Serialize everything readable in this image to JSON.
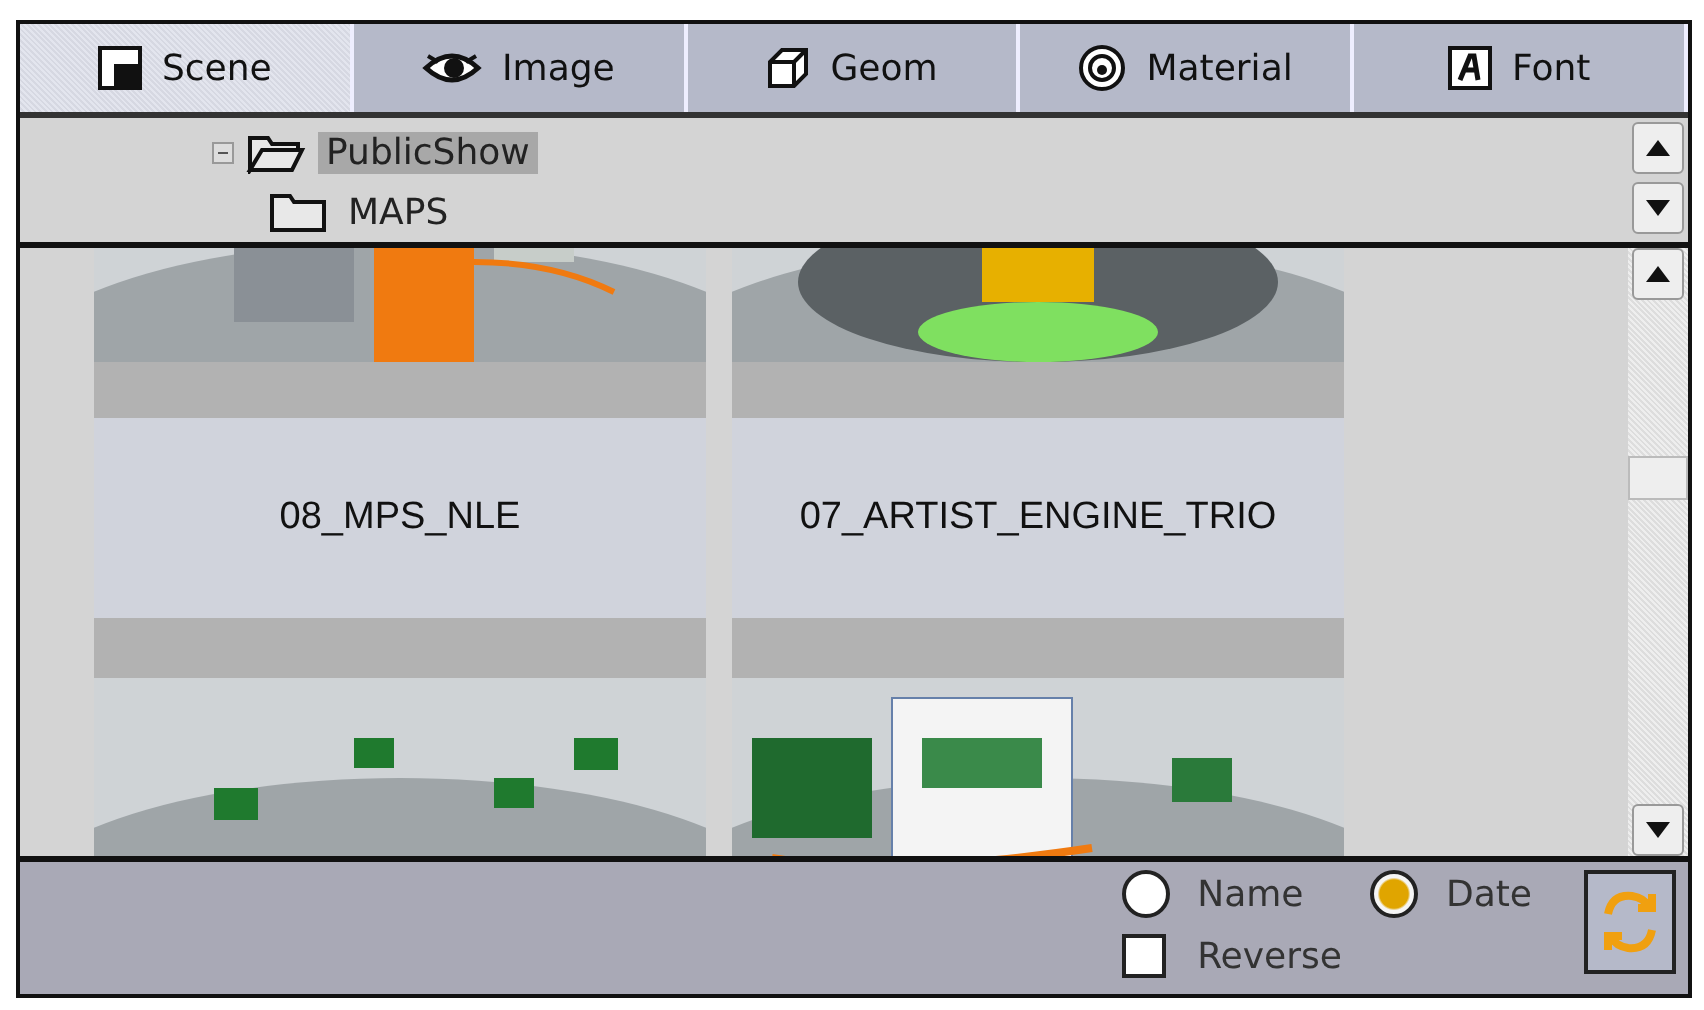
{
  "tabs": [
    {
      "label": "Scene",
      "selected": true
    },
    {
      "label": "Image",
      "selected": false
    },
    {
      "label": "Geom",
      "selected": false
    },
    {
      "label": "Material",
      "selected": false
    },
    {
      "label": "Font",
      "selected": false
    }
  ],
  "tree": [
    {
      "label": "PublicShow",
      "expanded": true,
      "selected": true,
      "children": [
        {
          "label": "MAPS",
          "selected": false
        }
      ]
    }
  ],
  "thumbnails": [
    {
      "label": "08_MPS_NLE",
      "kind": "picture"
    },
    {
      "label": "07_ARTIST_ENGINE_TRIO",
      "kind": "picture"
    },
    {
      "kind": "picture"
    },
    {
      "kind": "picture"
    }
  ],
  "sort": [
    {
      "label": "Name",
      "selected": false
    },
    {
      "label": "Date",
      "selected": true
    }
  ],
  "reverse": {
    "label": "Reverse",
    "checked": false
  }
}
